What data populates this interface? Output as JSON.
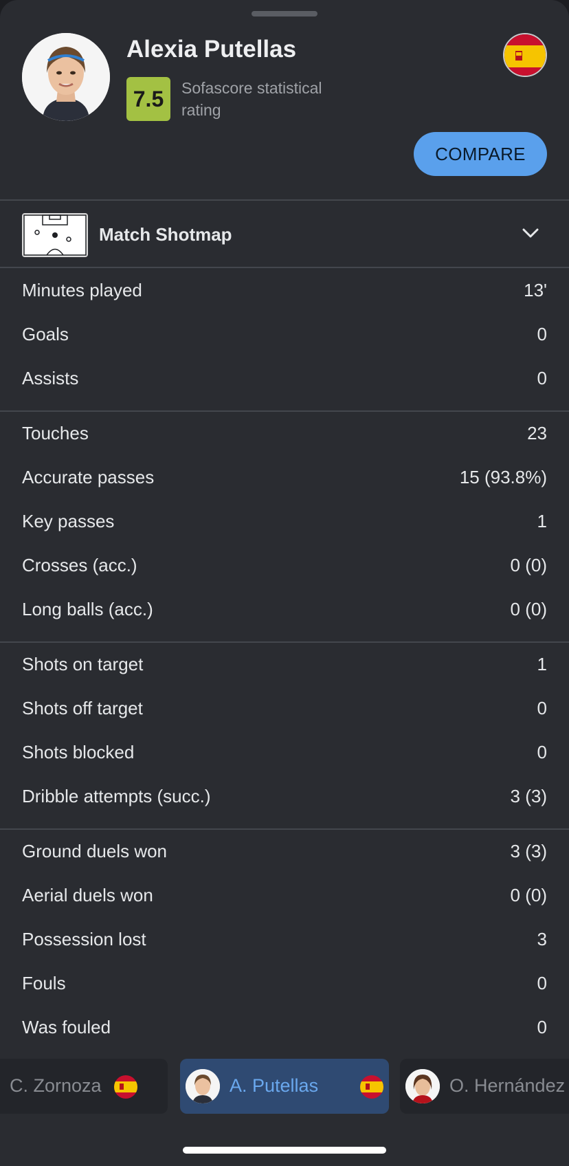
{
  "header": {
    "player_name": "Alexia Putellas",
    "rating": "7.5",
    "rating_label": "Sofascore statistical rating",
    "compare_label": "COMPARE",
    "flag_icon": "spain-flag-icon"
  },
  "shotmap": {
    "title": "Match Shotmap"
  },
  "stats": {
    "group1": [
      {
        "label": "Minutes played",
        "value": "13'"
      },
      {
        "label": "Goals",
        "value": "0"
      },
      {
        "label": "Assists",
        "value": "0"
      }
    ],
    "group2": [
      {
        "label": "Touches",
        "value": "23"
      },
      {
        "label": "Accurate passes",
        "value": "15 (93.8%)"
      },
      {
        "label": "Key passes",
        "value": "1"
      },
      {
        "label": "Crosses (acc.)",
        "value": "0 (0)"
      },
      {
        "label": "Long balls (acc.)",
        "value": "0 (0)"
      }
    ],
    "group3": [
      {
        "label": "Shots on target",
        "value": "1"
      },
      {
        "label": "Shots off target",
        "value": "0"
      },
      {
        "label": "Shots blocked",
        "value": "0"
      },
      {
        "label": "Dribble attempts (succ.)",
        "value": "3 (3)"
      }
    ],
    "group4": [
      {
        "label": "Ground duels won",
        "value": "3 (3)"
      },
      {
        "label": "Aerial duels won",
        "value": "0 (0)"
      },
      {
        "label": "Possession lost",
        "value": "3"
      },
      {
        "label": "Fouls",
        "value": "0"
      },
      {
        "label": "Was fouled",
        "value": "0"
      }
    ]
  },
  "carousel": {
    "players": [
      {
        "name": "C. Zornoza",
        "active": false
      },
      {
        "name": "A. Putellas",
        "active": true
      },
      {
        "name": "O. Hernández",
        "active": false
      }
    ]
  },
  "colors": {
    "background": "#2a2c31",
    "rating_green": "#a3c143",
    "accent_blue": "#5aa0ec",
    "active_chip": "#2f4a72"
  }
}
